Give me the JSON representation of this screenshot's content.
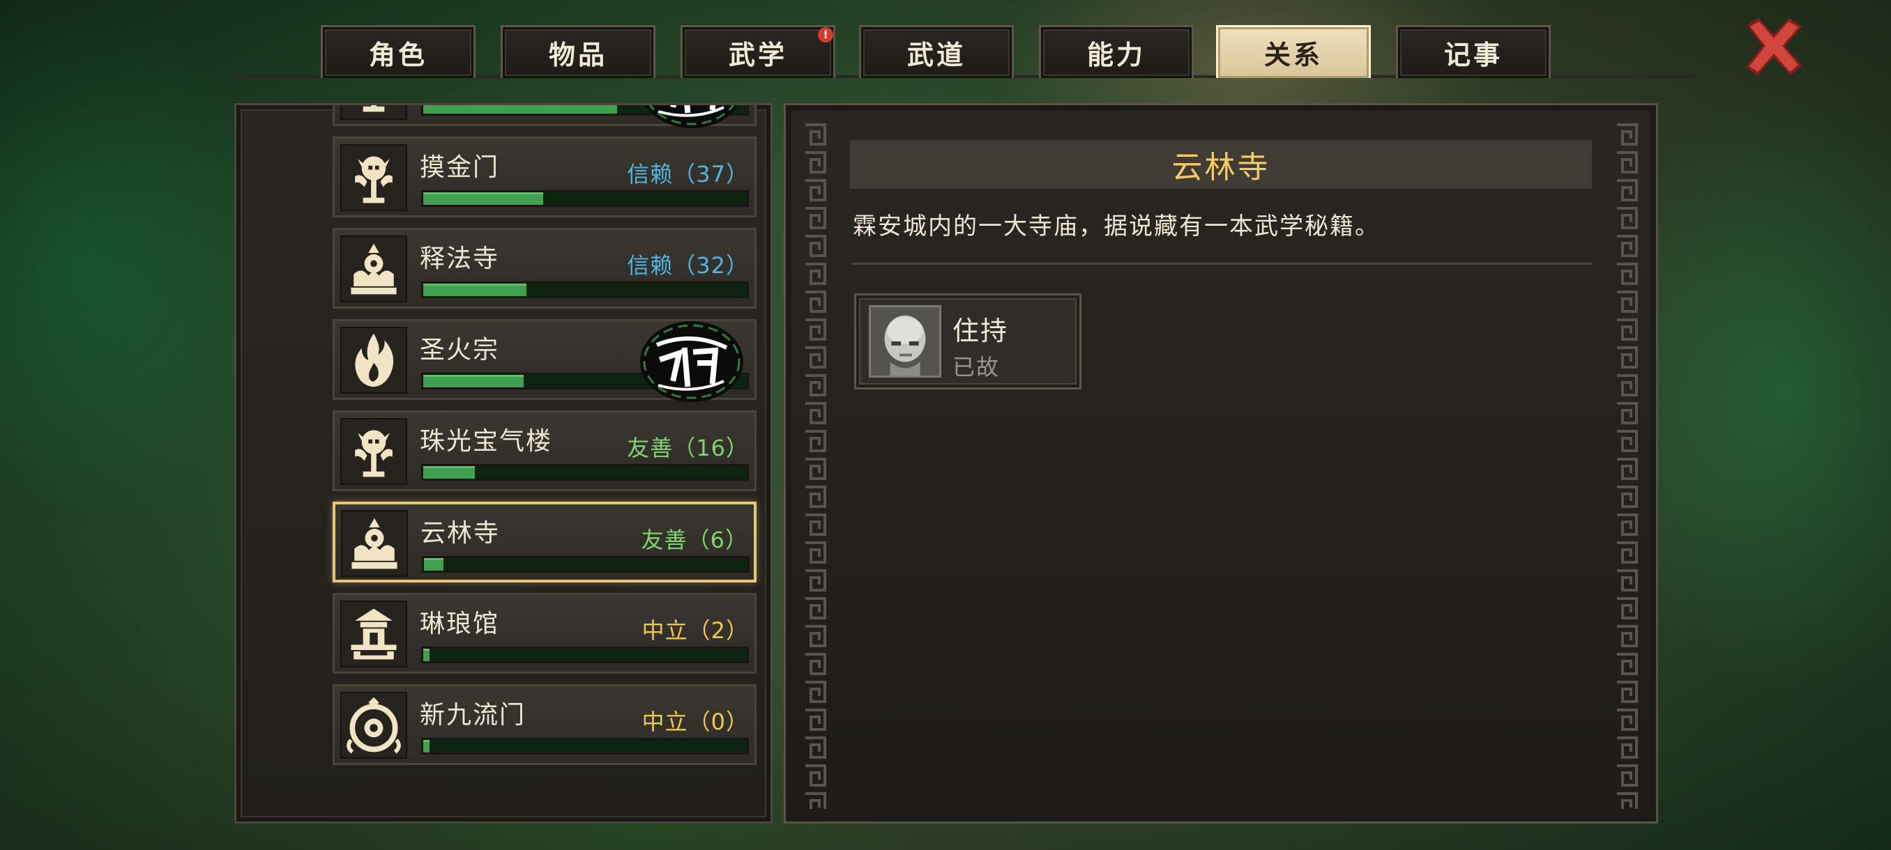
{
  "tabs": [
    {
      "label": "角色",
      "active": false,
      "badge": false
    },
    {
      "label": "物品",
      "active": false,
      "badge": false
    },
    {
      "label": "武学",
      "active": false,
      "badge": true,
      "badge_text": "!"
    },
    {
      "label": "武道",
      "active": false,
      "badge": false
    },
    {
      "label": "能力",
      "active": false,
      "badge": false
    },
    {
      "label": "关系",
      "active": true,
      "badge": false
    },
    {
      "label": "记事",
      "active": false,
      "badge": false
    }
  ],
  "close_icon": "close-x-icon",
  "colors": {
    "trust": "#4fb6e0",
    "friendly": "#7ed46e",
    "neutral": "#f1c84a",
    "title": "#f5cd63",
    "selected_border": "#e7c777"
  },
  "factions": [
    {
      "name": "",
      "status": "",
      "level": "",
      "progress": 0.6,
      "emblem": "skull-emblem-icon",
      "destroyed": true,
      "partial": true
    },
    {
      "name": "摸金门",
      "status": "信赖（37）",
      "level": "trust",
      "progress": 0.37,
      "emblem": "skull-emblem-icon",
      "destroyed": false
    },
    {
      "name": "释法寺",
      "status": "信赖（32）",
      "level": "trust",
      "progress": 0.32,
      "emblem": "temple-emblem-icon",
      "destroyed": false
    },
    {
      "name": "圣火宗",
      "status": "",
      "level": "",
      "progress": 0.31,
      "emblem": "flame-emblem-icon",
      "destroyed": true
    },
    {
      "name": "珠光宝气楼",
      "status": "友善（16）",
      "level": "friendly",
      "progress": 0.16,
      "emblem": "skull-emblem-icon",
      "destroyed": false
    },
    {
      "name": "云林寺",
      "status": "友善（6）",
      "level": "friendly",
      "progress": 0.06,
      "emblem": "temple-emblem-icon",
      "destroyed": false,
      "selected": true
    },
    {
      "name": "琳琅馆",
      "status": "中立（2）",
      "level": "neutral",
      "progress": 0.02,
      "emblem": "pavilion-emblem-icon",
      "destroyed": false
    },
    {
      "name": "新九流门",
      "status": "中立（0）",
      "level": "neutral",
      "progress": 0.0,
      "emblem": "swirl-emblem-icon",
      "destroyed": false
    }
  ],
  "detail": {
    "title": "云林寺",
    "description": "霖安城内的一大寺庙，据说藏有一本武学秘籍。",
    "members": [
      {
        "name": "住持",
        "status": "已故",
        "portrait": "monk-portrait-icon"
      }
    ]
  }
}
